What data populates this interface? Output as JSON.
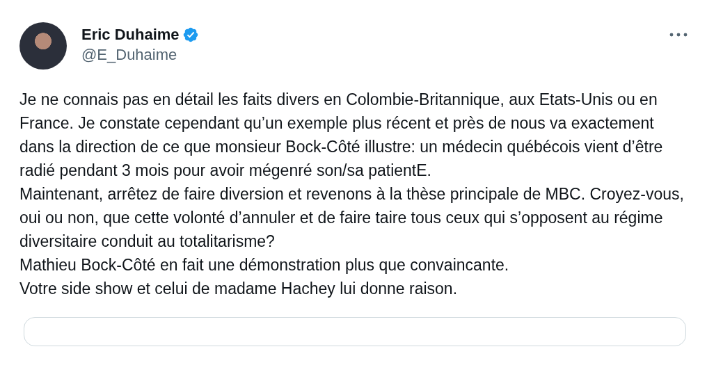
{
  "author": {
    "name": "Eric Duhaime",
    "verified": true,
    "handle": "@E_Duhaime"
  },
  "paragraphs": [
    "Je ne connais pas en détail les faits divers en Colombie-Britannique, aux Etats-Unis ou en France. Je constate cependant qu’un exemple plus récent et près de nous va exactement dans la direction de ce que monsieur Bock-Côté illustre: un médecin québécois vient d’être radié pendant 3 mois pour avoir mégenré son/sa patientE.",
    "Maintenant, arrêtez de faire diversion et revenons à la thèse principale de MBC. Croyez-vous, oui ou non, que cette volonté d’annuler et de faire taire tous ceux qui s’opposent au régime diversitaire conduit au totalitarisme?",
    "Mathieu Bock-Côté en fait une démonstration plus que convaincante.",
    "Votre side show et celui de madame Hachey lui donne raison."
  ]
}
